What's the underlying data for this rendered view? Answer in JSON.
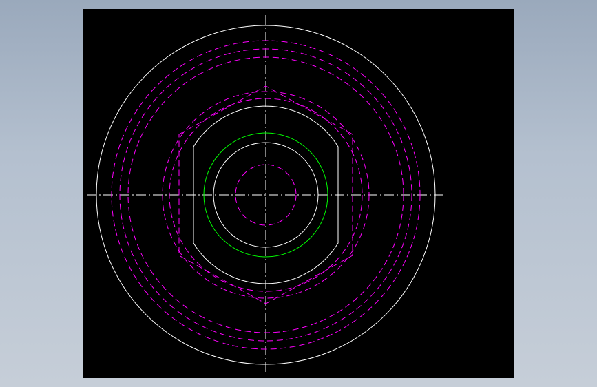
{
  "colors": {
    "background": "#a9b6c6",
    "viewport": "#000000",
    "outline": "#ffffff",
    "hidden": "#ff00ff",
    "thread": "#00ff00",
    "centerline": "#ffffff"
  }
}
